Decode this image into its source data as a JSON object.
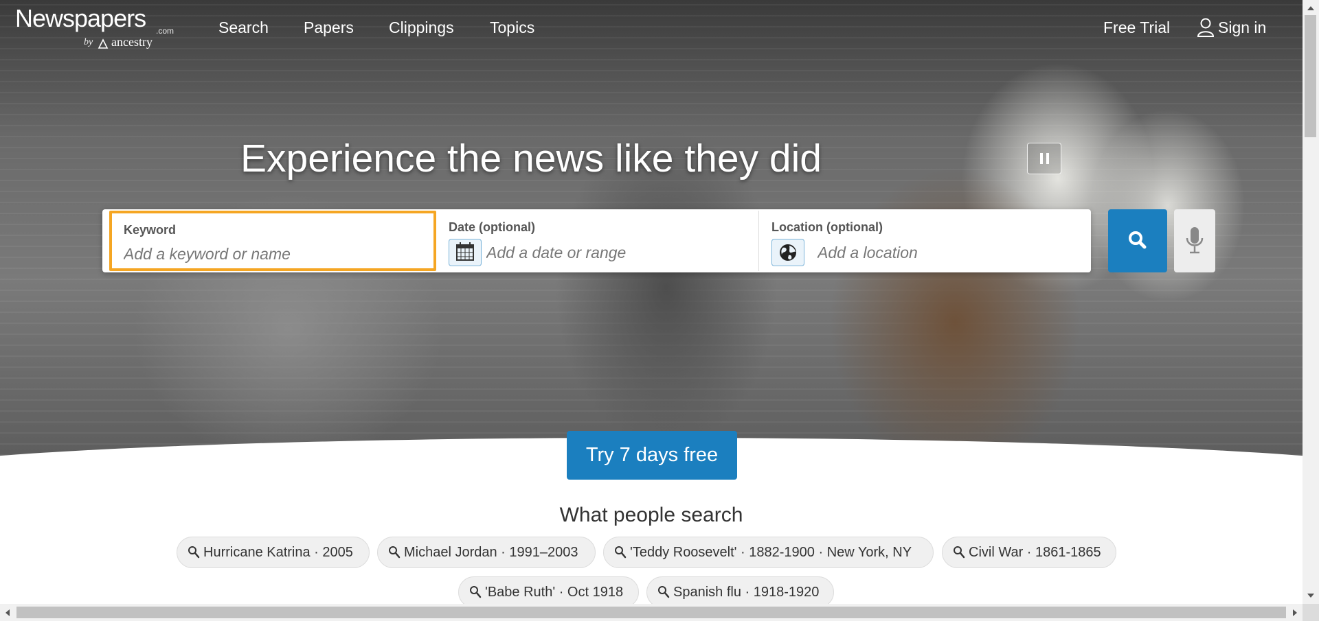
{
  "brand": {
    "logo_word": "Newspapers",
    "logo_com": ".com",
    "logo_by": "by",
    "logo_ancestry": "ancestry"
  },
  "nav": {
    "items": [
      {
        "label": "Search"
      },
      {
        "label": "Papers"
      },
      {
        "label": "Clippings"
      },
      {
        "label": "Topics"
      }
    ],
    "free_trial": "Free Trial",
    "sign_in": "Sign in"
  },
  "hero": {
    "headline": "Experience the news like they did"
  },
  "search": {
    "keyword_label": "Keyword",
    "keyword_placeholder": "Add a keyword or name",
    "date_label": "Date (optional)",
    "date_placeholder": "Add a date or range",
    "location_label": "Location (optional)",
    "location_placeholder": "Add a location"
  },
  "cta": {
    "label": "Try 7 days free"
  },
  "popular": {
    "title": "What people search",
    "items": [
      {
        "label": "Hurricane Katrina · 2005"
      },
      {
        "label": "Michael Jordan · 1991–2003"
      },
      {
        "label": "'Teddy Roosevelt' · 1882-1900 · New York, NY"
      },
      {
        "label": "Civil War · 1861-1865"
      },
      {
        "label": "'Babe Ruth' · Oct 1918"
      },
      {
        "label": "Spanish flu · 1918-1920"
      }
    ]
  },
  "colors": {
    "accent_blue": "#1b7fbf",
    "focus_orange": "#f5a623"
  },
  "icons": [
    "search-icon",
    "user-icon",
    "pause-icon",
    "calendar-icon",
    "globe-icon",
    "microphone-icon"
  ]
}
